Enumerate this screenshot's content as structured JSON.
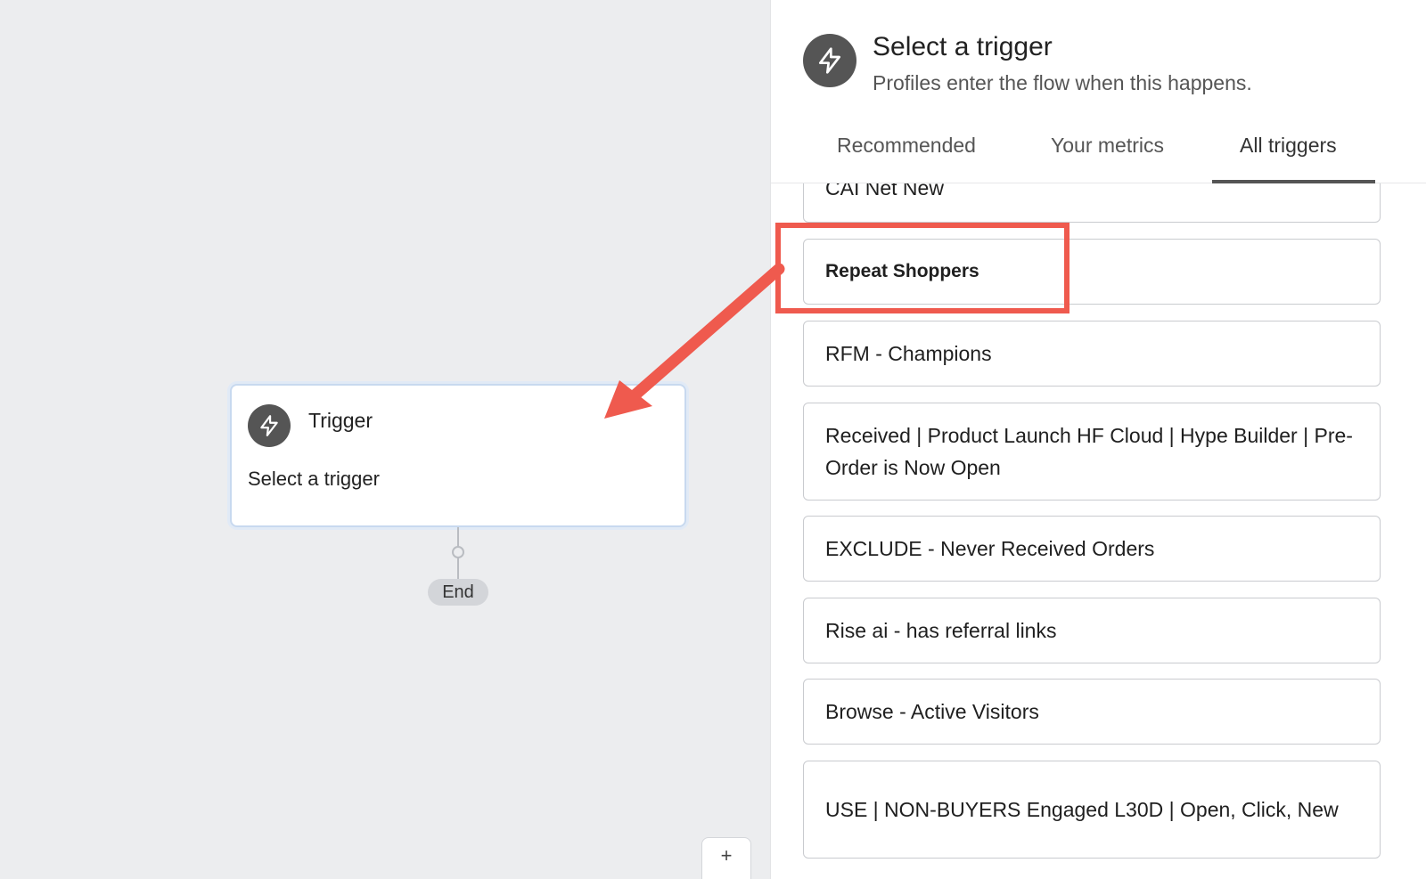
{
  "canvas": {
    "trigger_card": {
      "title": "Trigger",
      "subtitle": "Select a trigger",
      "icon": "lightning-icon"
    },
    "end_label": "End",
    "zoom_in_label": "+"
  },
  "panel": {
    "title": "Select a trigger",
    "subtitle": "Profiles enter the flow when this happens.",
    "icon": "lightning-icon",
    "tabs": [
      {
        "label": "Recommended",
        "active": false
      },
      {
        "label": "Your metrics",
        "active": false
      },
      {
        "label": "All triggers",
        "active": true
      }
    ],
    "items": [
      {
        "label": "CAI Net New"
      },
      {
        "label": "Repeat Shoppers",
        "highlighted": true
      },
      {
        "label": "RFM - Champions"
      },
      {
        "label": "Received | Product Launch HF Cloud | Hype Builder | Pre-Order is Now Open"
      },
      {
        "label": "EXCLUDE - Never Received Orders"
      },
      {
        "label": "Rise ai - has referral links"
      },
      {
        "label": "Browse - Active Visitors"
      },
      {
        "label": "USE | NON-BUYERS Engaged L30D | Open, Click, New"
      }
    ]
  },
  "annotation": {
    "color": "#ef5a4e"
  }
}
